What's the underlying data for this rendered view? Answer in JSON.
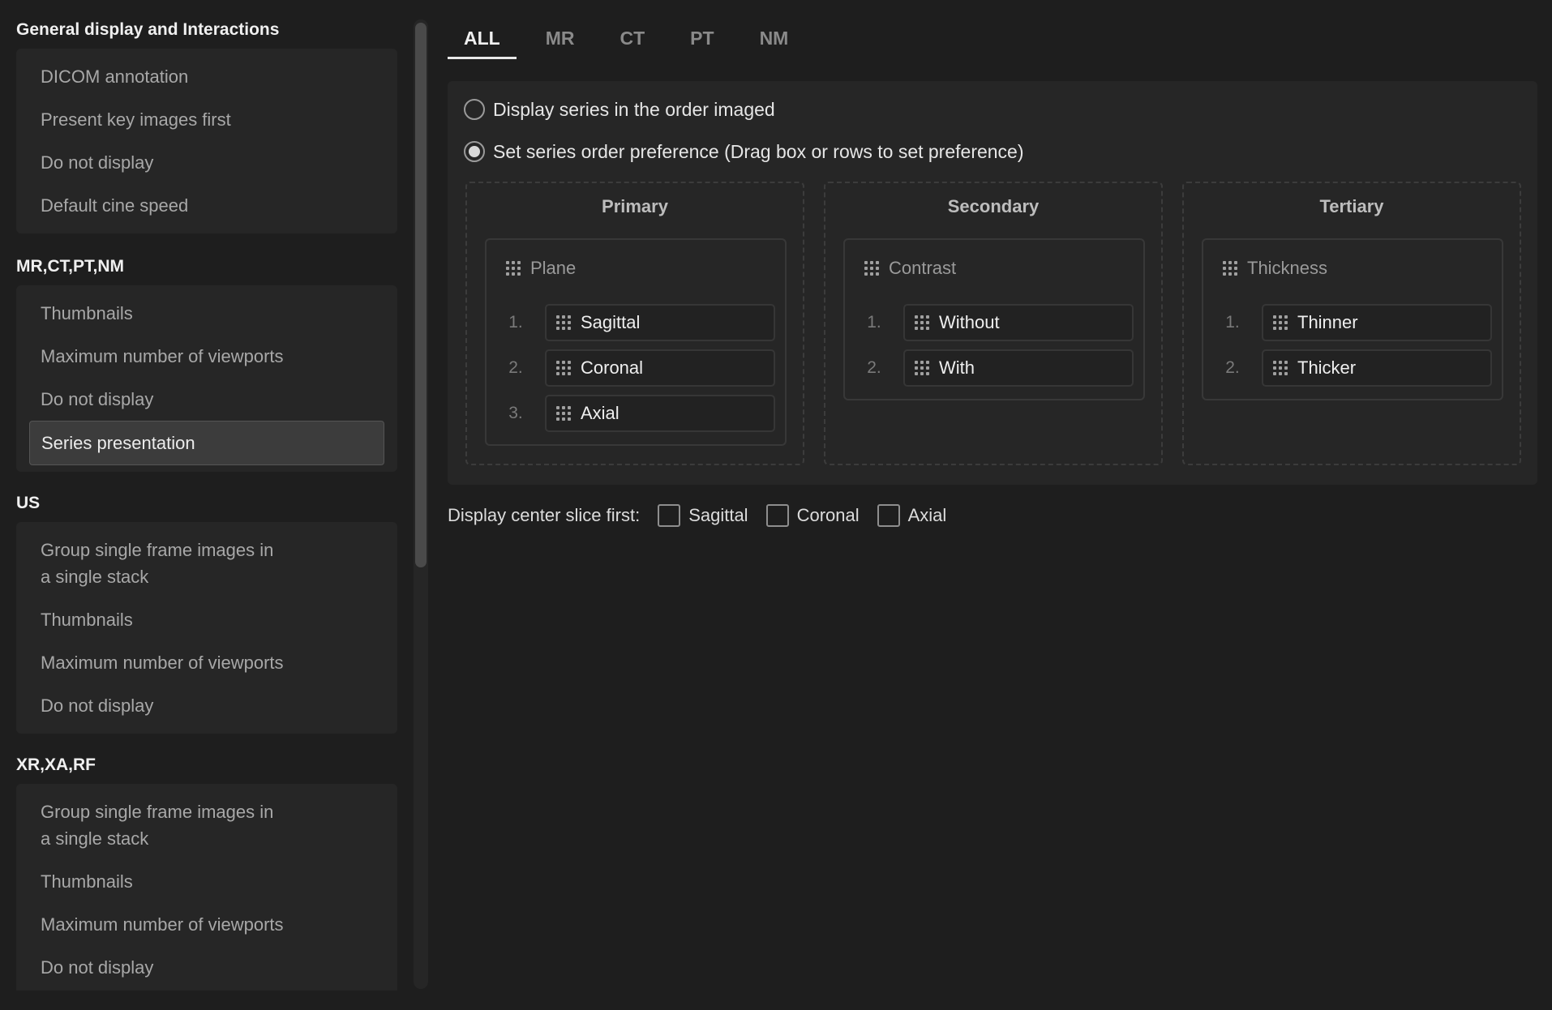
{
  "sidebar": {
    "sections": [
      {
        "title": "General display and Interactions",
        "items": [
          "DICOM annotation",
          "Present key images first",
          "Do not display",
          "Default cine speed"
        ]
      },
      {
        "title": "MR,CT,PT,NM",
        "items": [
          "Thumbnails",
          "Maximum number of viewports",
          "Do not display",
          "Series presentation"
        ],
        "active_item": "Series presentation"
      },
      {
        "title": "US",
        "items": [
          "Group single frame images in a single stack",
          "Thumbnails",
          "Maximum number of viewports",
          "Do not display"
        ]
      },
      {
        "title": "XR,XA,RF",
        "items": [
          "Group single frame images in a single stack",
          "Thumbnails",
          "Maximum number of viewports",
          "Do not display"
        ]
      }
    ]
  },
  "tabs": [
    "ALL",
    "MR",
    "CT",
    "PT",
    "NM"
  ],
  "active_tab": "ALL",
  "series_order": {
    "option_imaged": "Display series in the order imaged",
    "option_preference": "Set series order preference (Drag box or rows to set preference)",
    "selected": "option_preference"
  },
  "preferences": [
    {
      "rank": "Primary",
      "criterion": "Plane",
      "options": [
        {
          "num": "1.",
          "label": "Sagittal"
        },
        {
          "num": "2.",
          "label": "Coronal"
        },
        {
          "num": "3.",
          "label": "Axial"
        }
      ]
    },
    {
      "rank": "Secondary",
      "criterion": "Contrast",
      "options": [
        {
          "num": "1.",
          "label": "Without"
        },
        {
          "num": "2.",
          "label": "With"
        }
      ]
    },
    {
      "rank": "Tertiary",
      "criterion": "Thickness",
      "options": [
        {
          "num": "1.",
          "label": "Thinner"
        },
        {
          "num": "2.",
          "label": "Thicker"
        }
      ]
    }
  ],
  "center_slice": {
    "label": "Display center slice first:",
    "options": [
      {
        "label": "Sagittal",
        "checked": false
      },
      {
        "label": "Coronal",
        "checked": false
      },
      {
        "label": "Axial",
        "checked": false
      }
    ]
  },
  "colors": {
    "background": "#1e1e1e",
    "panel": "#262626",
    "active_item": "#3c3c3c",
    "text_primary": "#f0f0f0",
    "text_muted": "#a8a8a8"
  }
}
